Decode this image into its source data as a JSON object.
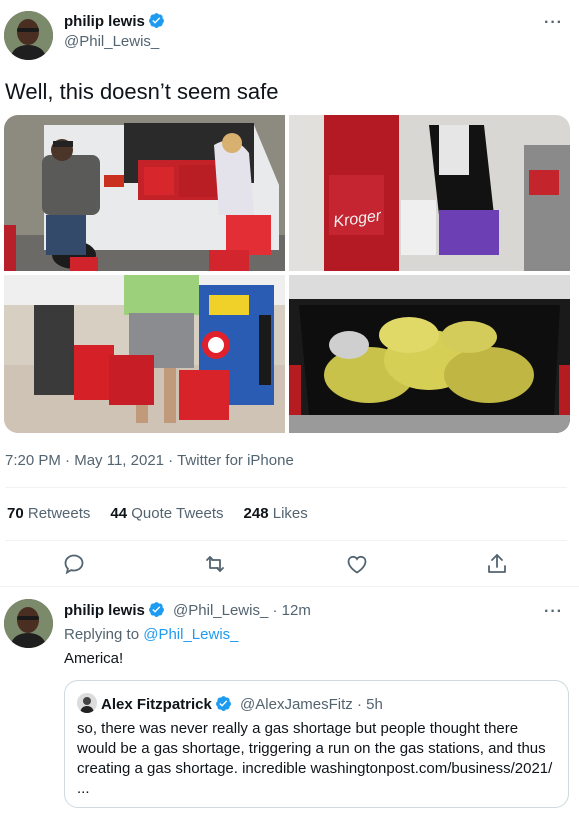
{
  "main_tweet": {
    "author_name": "philip lewis",
    "author_handle": "@Phil_Lewis_",
    "text": "Well, this doesn’t seem safe",
    "time": "7:20 PM",
    "date": "May 11, 2021",
    "source": "Twitter for iPhone",
    "separator": " · ",
    "more_icon": "···"
  },
  "stats": {
    "retweets_count": "70",
    "retweets_label": "Retweets",
    "quote_count": "44",
    "quote_label": "Quote Tweets",
    "likes_count": "248",
    "likes_label": "Likes"
  },
  "media": {
    "photo3_sign": "Kroger"
  },
  "reply_tweet": {
    "author_name": "philip lewis",
    "author_handle": "@Phil_Lewis_",
    "time_ago": "12m",
    "dot": " · ",
    "replying_prefix": "Replying to",
    "replying_to": "@Phil_Lewis_",
    "text": "America!",
    "more_icon": "···"
  },
  "quote_tweet": {
    "author_name": "Alex Fitzpatrick",
    "author_handle": "@AlexJamesFitz",
    "time_ago": "5h",
    "dot": " · ",
    "text_line1": "so, there was never really a gas shortage but people thought there",
    "text_line2": "would be a gas shortage, triggering a run on the gas stations, and thus",
    "text_line3": "creating a gas shortage. incredible washingtonpost.com/business/2021/",
    "text_line4": "..."
  },
  "colors": {
    "accent": "#1d9bf0",
    "text": "#0f1419",
    "secondary": "#536471",
    "border": "#cfd9de"
  },
  "icons": [
    "verified-badge-icon",
    "more-icon",
    "reply-icon",
    "retweet-icon",
    "like-icon",
    "share-icon"
  ]
}
